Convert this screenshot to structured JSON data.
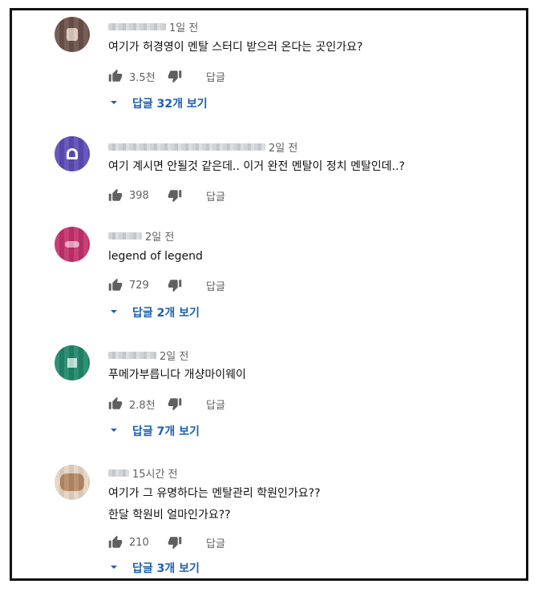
{
  "comments": [
    {
      "time": "1일 전",
      "text_lines": [
        "여기가 허경영이 멘탈 스터디 받으러 온다는 곳인가요?"
      ],
      "likes": "3.5천",
      "reply_label": "답글",
      "view_replies": "답글 32개 보기",
      "avatar_color": "#6b5048"
    },
    {
      "time": "2일 전",
      "text_lines": [
        "여기 계시면 안될것 같은데.. 이거 완전 멘탈이 정치 멘탈인데..?"
      ],
      "likes": "398",
      "reply_label": "답글",
      "avatar_color": "#5c4bb5"
    },
    {
      "time": "2일 전",
      "text_lines": [
        "legend of legend"
      ],
      "likes": "729",
      "reply_label": "답글",
      "view_replies": "답글 2개 보기",
      "avatar_color": "#c2306a"
    },
    {
      "time": "2일 전",
      "text_lines": [
        "푸메가부릅니다 개샹마이웨이"
      ],
      "likes": "2.8천",
      "reply_label": "답글",
      "view_replies": "답글 7개 보기",
      "avatar_color": "#20866a"
    },
    {
      "time": "15시간 전",
      "text_lines": [
        "여기가 그 유명하다는 멘탈관리 학원인가요??",
        "한달 학원비 얼마인가요??"
      ],
      "likes": "210",
      "reply_label": "답글",
      "view_replies": "답글 3개 보기",
      "avatar_color": "#c9a98a"
    }
  ],
  "colors": {
    "link": "#1a5fb4",
    "meta": "#606060",
    "text": "#111111"
  },
  "icons": {
    "like": "thumbs-up-icon",
    "dislike": "thumbs-down-icon",
    "expand": "caret-down-icon"
  }
}
